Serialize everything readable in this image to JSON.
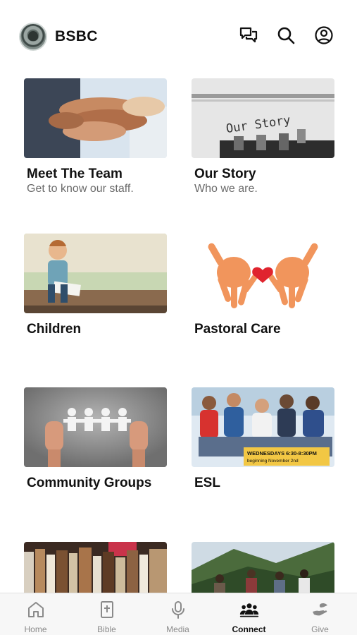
{
  "header": {
    "brand": "BSBC",
    "icons": [
      "chat-icon",
      "search-icon",
      "profile-icon"
    ]
  },
  "cards": [
    {
      "title": "Meet The Team",
      "subtitle": "Get to know our staff.",
      "image": "hands-together-photo"
    },
    {
      "title": "Our Story",
      "subtitle": "Who we are.",
      "image": "typewriter-photo",
      "image_text": "Our Story"
    },
    {
      "title": "Children",
      "subtitle": "",
      "image": "child-reading-photo"
    },
    {
      "title": "Pastoral Care",
      "subtitle": "",
      "image": "handprints-heart-illustration"
    },
    {
      "title": "Community Groups",
      "subtitle": "",
      "image": "paper-people-chain-photo"
    },
    {
      "title": "ESL",
      "subtitle": "",
      "image": "group-of-friends-photo",
      "banner_line1": "WEDNESDAYS 6:30-8:30PM",
      "banner_line2": "beginning November 2nd"
    },
    {
      "title": "",
      "subtitle": "",
      "image": "books-photo"
    },
    {
      "title": "",
      "subtitle": "",
      "image": "hikers-mountain-photo"
    }
  ],
  "tabs": [
    {
      "label": "Home",
      "icon": "home-icon",
      "active": false
    },
    {
      "label": "Bible",
      "icon": "bible-icon",
      "active": false
    },
    {
      "label": "Media",
      "icon": "microphone-icon",
      "active": false
    },
    {
      "label": "Connect",
      "icon": "people-icon",
      "active": true
    },
    {
      "label": "Give",
      "icon": "giving-hand-icon",
      "active": false
    }
  ],
  "colors": {
    "active_tab": "#111111",
    "inactive_tab": "#8a8a8a",
    "banner": "#f2c744"
  }
}
